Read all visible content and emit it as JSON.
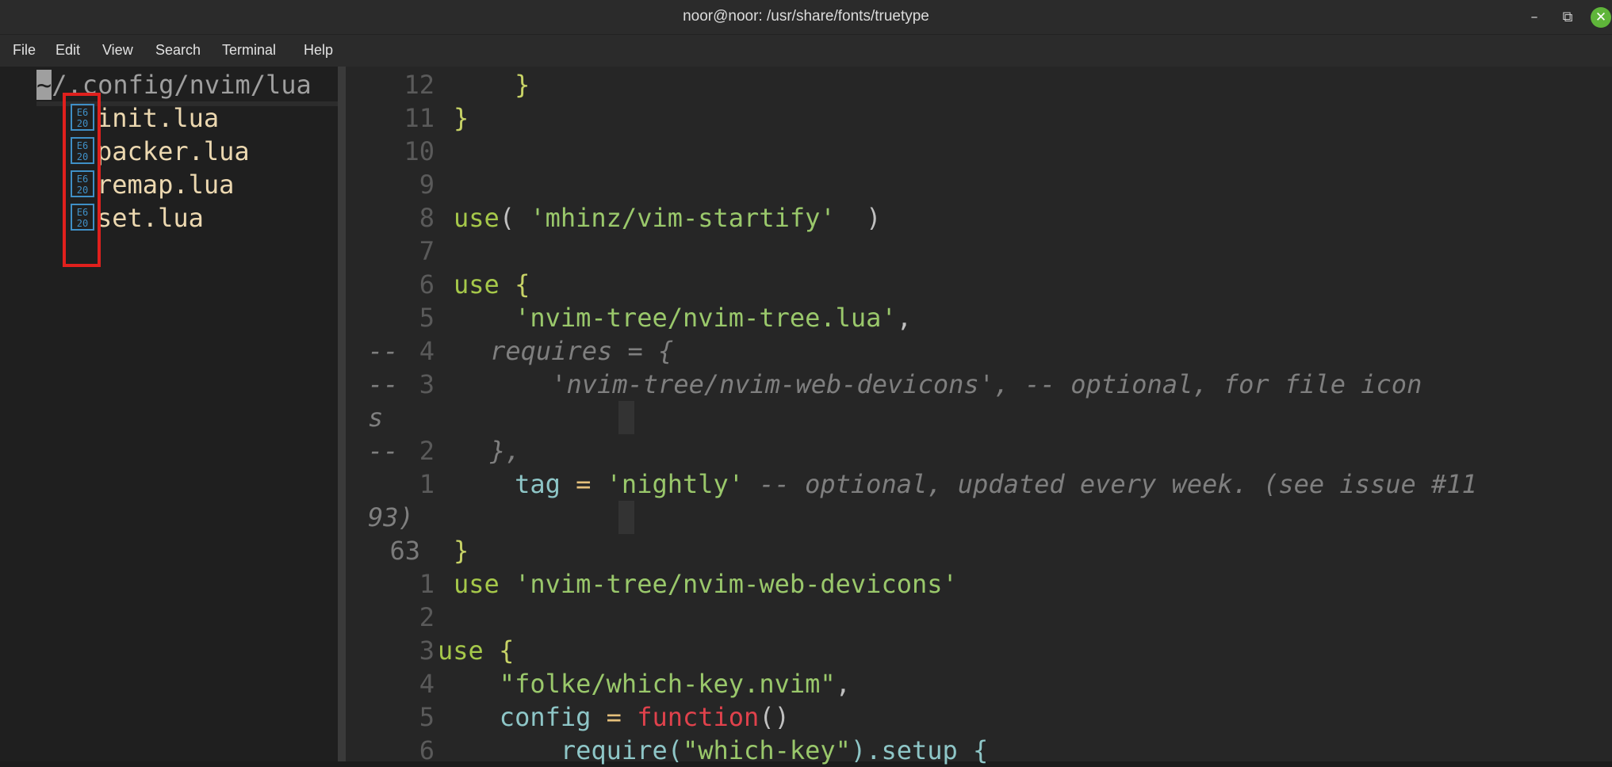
{
  "window": {
    "title": "noor@noor: /usr/share/fonts/truetype",
    "controls": {
      "minimize": "–",
      "maximize": "⧉",
      "close": "✕"
    }
  },
  "menu": [
    "File",
    "Edit",
    "View",
    "Search",
    "Terminal",
    "Help"
  ],
  "tree": {
    "path_tilde": "~",
    "path_rest": "/.config/nvim/lua",
    "icon_label": "E620",
    "files": [
      "init.lua",
      "packer.lua",
      "remap.lua",
      "set.lua"
    ]
  },
  "editor": {
    "lines": [
      {
        "num": "12",
        "segments": [
          {
            "t": "    }",
            "c": "brace"
          }
        ]
      },
      {
        "num": "11",
        "segments": [
          {
            "t": "}",
            "c": "brace"
          }
        ]
      },
      {
        "num": "10",
        "segments": []
      },
      {
        "num": "9",
        "segments": []
      },
      {
        "num": "8",
        "segments": [
          {
            "t": "use",
            "c": "kw"
          },
          {
            "t": "( ",
            "c": "paren"
          },
          {
            "t": "'mhinz/vim-startify'",
            "c": "str"
          },
          {
            "t": "  )",
            "c": "paren"
          }
        ]
      },
      {
        "num": "7",
        "segments": []
      },
      {
        "num": "6",
        "segments": [
          {
            "t": "use ",
            "c": "kw"
          },
          {
            "t": "{",
            "c": "brace"
          }
        ]
      },
      {
        "num": "5",
        "segments": [
          {
            "t": "    'nvim-tree/nvim-tree.lua'",
            "c": "str"
          },
          {
            "t": ",",
            "c": "paren"
          }
        ]
      },
      {
        "num": "4",
        "segments": [
          {
            "t": "--      requires = {",
            "c": "comment"
          }
        ]
      },
      {
        "num": "3",
        "segments": [
          {
            "t": "--          'nvim-tree/nvim-web-devicons', -- optional, for file icon",
            "c": "comment"
          }
        ]
      },
      {
        "num": "",
        "segments": [
          {
            "t": "s",
            "c": "comment"
          }
        ]
      },
      {
        "num": "2",
        "segments": [
          {
            "t": "--      },",
            "c": "comment"
          }
        ]
      },
      {
        "num": "1",
        "segments": [
          {
            "t": "    tag ",
            "c": "id"
          },
          {
            "t": "=",
            "c": "op"
          },
          {
            "t": " 'nightly'",
            "c": "str"
          },
          {
            "t": " -- optional, updated every week. (see issue #11",
            "c": "comment"
          }
        ]
      },
      {
        "num": "",
        "segments": [
          {
            "t": "93)",
            "c": "comment"
          }
        ]
      },
      {
        "num": "63",
        "segments": [
          {
            "t": "}",
            "c": "brace"
          }
        ],
        "abs": true
      },
      {
        "num": "1",
        "segments": [
          {
            "t": "use ",
            "c": "kw"
          },
          {
            "t": "'nvim-tree/nvim-web-devicons'",
            "c": "str"
          }
        ]
      },
      {
        "num": "2",
        "segments": []
      },
      {
        "num": "3",
        "segments": [
          {
            "t": "use ",
            "c": "kw"
          },
          {
            "t": "{",
            "c": "brace"
          }
        ],
        "shift": -1
      },
      {
        "num": "4",
        "segments": [
          {
            "t": "   \"folke/which-key.nvim\"",
            "c": "str"
          },
          {
            "t": ",",
            "c": "paren"
          }
        ]
      },
      {
        "num": "5",
        "segments": [
          {
            "t": "   config ",
            "c": "id"
          },
          {
            "t": "=",
            "c": "op"
          },
          {
            "t": " function",
            "c": "fn"
          },
          {
            "t": "()",
            "c": "paren"
          }
        ]
      },
      {
        "num": "6",
        "segments": [
          {
            "t": "       require(",
            "c": "id"
          },
          {
            "t": "\"which-key\"",
            "c": "str"
          },
          {
            "t": ").setup {",
            "c": "id"
          }
        ]
      }
    ]
  }
}
